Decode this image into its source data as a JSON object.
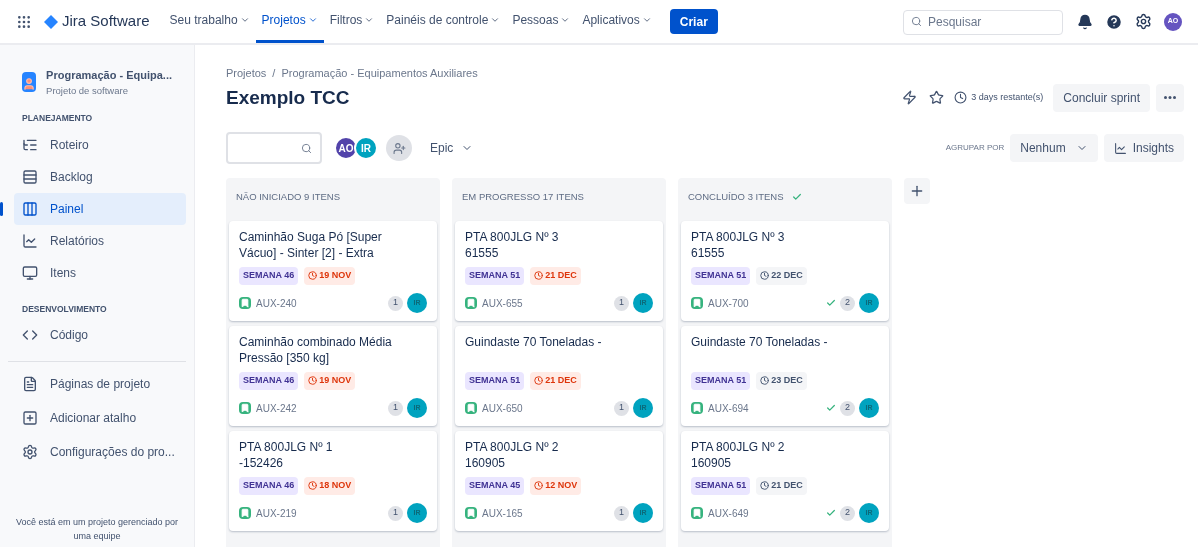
{
  "topbar": {
    "product": "Jira Software",
    "nav": [
      {
        "label": "Seu trabalho",
        "selected": false
      },
      {
        "label": "Projetos",
        "selected": true
      },
      {
        "label": "Filtros",
        "selected": false
      },
      {
        "label": "Painéis de controle",
        "selected": false
      },
      {
        "label": "Pessoas",
        "selected": false
      },
      {
        "label": "Aplicativos",
        "selected": false
      }
    ],
    "create": "Criar",
    "search": {
      "placeholder": "Pesquisar"
    },
    "avatar": "AO"
  },
  "sidebar": {
    "project": "Programação - Equipa...",
    "project_type": "Projeto de software",
    "sections": [
      {
        "heading": "PLANEJAMENTO",
        "items": [
          {
            "kind": "roadmap",
            "label": "Roteiro",
            "selected": false
          },
          {
            "kind": "backlog",
            "label": "Backlog",
            "selected": false
          },
          {
            "kind": "board",
            "label": "Painel",
            "selected": true
          },
          {
            "kind": "reports",
            "label": "Relatórios",
            "selected": false
          },
          {
            "kind": "issues",
            "label": "Itens",
            "selected": false
          }
        ]
      },
      {
        "heading": "DESENVOLVIMENTO",
        "items": [
          {
            "kind": "code",
            "label": "Código",
            "selected": false
          }
        ]
      }
    ],
    "footer_items": [
      {
        "kind": "pages",
        "label": "Páginas de projeto",
        "selected": false
      },
      {
        "kind": "shortcut",
        "label": "Adicionar atalho",
        "selected": false
      },
      {
        "kind": "settings",
        "label": "Configurações do pro...",
        "selected": false
      }
    ],
    "footer_note": "Você está em um projeto gerenciado por uma equipe"
  },
  "header": {
    "breadcrumb_separator": "/",
    "breadcrumbs": [
      "Projetos",
      "Programação - Equipamentos Auxiliares"
    ],
    "title": "Exemplo TCC",
    "remaining": "3 days restante(s)",
    "complete_button": "Concluir sprint"
  },
  "toolbar": {
    "avatars": [
      {
        "initials": "AO",
        "color": "#5243aa"
      },
      {
        "initials": "IR",
        "color": "#00a3bf"
      }
    ],
    "epic_filter": "Epic",
    "group_by_label": "AGRUPAR POR",
    "group_by_value": "Nenhum",
    "insights": "Insights"
  },
  "columns": [
    {
      "title": "NÃO INICIADO 9 ITENS",
      "done": false,
      "cards": [
        {
          "title": "Caminhão Suga Pó [Super\nVácuo] - Sinter [2] - Extra",
          "label": "SEMANA 46",
          "due": "19 NOV",
          "overdue": true,
          "key": "AUX-240",
          "resolved": false,
          "count": "1",
          "assignee": "IR"
        },
        {
          "title": "Caminhão combinado Média\nPressão [350 kg]",
          "label": "SEMANA 46",
          "due": "19 NOV",
          "overdue": true,
          "key": "AUX-242",
          "resolved": false,
          "count": "1",
          "assignee": "IR"
        },
        {
          "title": "PTA 800JLG Nº 1\n-152426",
          "label": "SEMANA 46",
          "due": "18 NOV",
          "overdue": true,
          "key": "AUX-219",
          "resolved": false,
          "count": "1",
          "assignee": "IR"
        }
      ]
    },
    {
      "title": "EM PROGRESSO 17 ITENS",
      "done": false,
      "cards": [
        {
          "title": "PTA 800JLG Nº 3\n61555",
          "label": "SEMANA 51",
          "due": "21 DEC",
          "overdue": true,
          "key": "AUX-655",
          "resolved": false,
          "count": "1",
          "assignee": "IR"
        },
        {
          "title": "Guindaste 70 Toneladas -",
          "label": "SEMANA 51",
          "due": "21 DEC",
          "overdue": true,
          "key": "AUX-650",
          "resolved": false,
          "count": "1",
          "assignee": "IR"
        },
        {
          "title": "PTA 800JLG Nº 2\n160905",
          "label": "SEMANA 45",
          "due": "12 NOV",
          "overdue": true,
          "key": "AUX-165",
          "resolved": false,
          "count": "1",
          "assignee": "IR"
        }
      ]
    },
    {
      "title": "CONCLUÍDO 3 ITENS",
      "done": true,
      "cards": [
        {
          "title": "PTA 800JLG Nº 3\n61555",
          "label": "SEMANA 51",
          "due": "22 DEC",
          "overdue": false,
          "key": "AUX-700",
          "resolved": true,
          "count": "2",
          "assignee": "IR"
        },
        {
          "title": "Guindaste 70 Toneladas -",
          "label": "SEMANA 51",
          "due": "23 DEC",
          "overdue": false,
          "key": "AUX-694",
          "resolved": true,
          "count": "2",
          "assignee": "IR"
        },
        {
          "title": "PTA 800JLG Nº 2\n160905",
          "label": "SEMANA 51",
          "due": "21 DEC",
          "overdue": false,
          "key": "AUX-649",
          "resolved": true,
          "count": "2",
          "assignee": "IR"
        }
      ]
    }
  ]
}
